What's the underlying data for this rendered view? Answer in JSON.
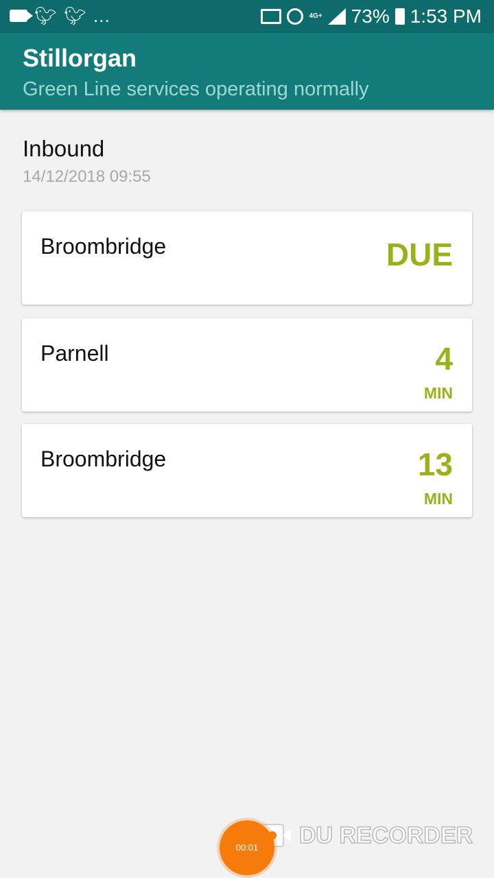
{
  "status_bar": {
    "left_icons": [
      "video-camera-icon",
      "twitter-icon",
      "twitter-icon",
      "more-notifications-icon"
    ],
    "more": "...",
    "network_label": "4G+",
    "battery_percent": "73%",
    "time": "1:53 PM"
  },
  "app_bar": {
    "title": "Stillorgan",
    "subtitle": "Green Line services operating normally"
  },
  "section": {
    "direction": "Inbound",
    "timestamp": "14/12/2018 09:55"
  },
  "departures": [
    {
      "destination": "Broombridge",
      "due": "DUE",
      "minutes": "",
      "unit": ""
    },
    {
      "destination": "Parnell",
      "due": "",
      "minutes": "4",
      "unit": "MIN"
    },
    {
      "destination": "Broombridge",
      "due": "",
      "minutes": "13",
      "unit": "MIN"
    }
  ],
  "recorder": {
    "elapsed": "00:01",
    "brand": "DU RECORDER"
  },
  "colors": {
    "status_bar": "#0d6b6b",
    "app_bar": "#147b7b",
    "subtitle": "#9ed9d1",
    "due_accent": "#98b319",
    "background": "#f2f2f2",
    "recorder_orange": "#f57c0b"
  }
}
